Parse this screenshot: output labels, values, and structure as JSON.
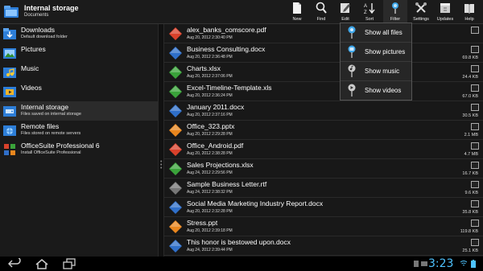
{
  "header": {
    "title": "Internal storage",
    "subtitle": "Documents"
  },
  "toolbar": [
    {
      "label": "New",
      "icon": "new-document-icon"
    },
    {
      "label": "Find",
      "icon": "find-icon"
    },
    {
      "label": "Edit",
      "icon": "edit-icon"
    },
    {
      "label": "Sort",
      "icon": "sort-icon"
    },
    {
      "label": "Filter",
      "icon": "filter-icon"
    },
    {
      "label": "Settings",
      "icon": "settings-icon"
    },
    {
      "label": "Updates",
      "icon": "updates-icon"
    },
    {
      "label": "Help",
      "icon": "help-icon"
    }
  ],
  "sidebar": {
    "items": [
      {
        "label": "Downloads",
        "sub": "Default download folder",
        "icon": "download-folder-icon"
      },
      {
        "label": "Pictures",
        "sub": "",
        "icon": "pictures-icon"
      },
      {
        "label": "Music",
        "sub": "",
        "icon": "music-icon"
      },
      {
        "label": "Videos",
        "sub": "",
        "icon": "videos-icon"
      },
      {
        "label": "Internal storage",
        "sub": "Files saved on internal storage",
        "icon": "internal-storage-icon"
      },
      {
        "label": "Remote files",
        "sub": "Files stored on remote servers",
        "icon": "remote-files-icon"
      },
      {
        "label": "OfficeSuite Professional 6",
        "sub": "Install OfficeSuite Professional",
        "icon": "officesuite-icon"
      }
    ]
  },
  "files": [
    {
      "name": "alex_banks_comscore.pdf",
      "date": "Aug 20, 2012 2:30:40 PM",
      "size": "",
      "type": "pdf",
      "color": "#d9412b"
    },
    {
      "name": "Business Consulting.docx",
      "date": "Aug 20, 2012 2:36:48 PM",
      "size": "69.8 KB",
      "type": "docx",
      "color": "#2f6fc9"
    },
    {
      "name": "Charts.xlsx",
      "date": "Aug 20, 2012 2:37:06 PM",
      "size": "24.4 KB",
      "type": "xlsx",
      "color": "#3aa33a"
    },
    {
      "name": "Excel-Timeline-Template.xls",
      "date": "Aug 20, 2012 2:36:24 PM",
      "size": "67.0 KB",
      "type": "xls",
      "color": "#3aa33a"
    },
    {
      "name": "January 2011.docx",
      "date": "Aug 20, 2012 2:37:16 PM",
      "size": "30.5 KB",
      "type": "docx",
      "color": "#2f6fc9"
    },
    {
      "name": "Office_323.pptx",
      "date": "Aug 20, 2012 2:29:28 PM",
      "size": "2.1 MB",
      "type": "pptx",
      "color": "#e9861e"
    },
    {
      "name": "Office_Android.pdf",
      "date": "Aug 20, 2012 2:38:28 PM",
      "size": "4.7 MB",
      "type": "pdf",
      "color": "#d9412b"
    },
    {
      "name": "Sales Projections.xlsx",
      "date": "Aug 24, 2012 2:29:56 PM",
      "size": "16.7 KB",
      "type": "xlsx",
      "color": "#3aa33a"
    },
    {
      "name": "Sample Business Letter.rtf",
      "date": "Aug 24, 2012 2:38:32 PM",
      "size": "9.6 KB",
      "type": "rtf",
      "color": "#777777"
    },
    {
      "name": "Social Media Marketing Industry Report.docx",
      "date": "Aug 20, 2012 2:32:28 PM",
      "size": "35.8 KB",
      "type": "docx",
      "color": "#2f6fc9"
    },
    {
      "name": "Stress.ppt",
      "date": "Aug 20, 2012 2:39:18 PM",
      "size": "119.8 KB",
      "type": "ppt",
      "color": "#e9861e"
    },
    {
      "name": "This honor is bestowed upon.docx",
      "date": "Aug 24, 2012 2:39:44 PM",
      "size": "25.1 KB",
      "type": "docx",
      "color": "#2f6fc9"
    }
  ],
  "filter_menu": {
    "items": [
      {
        "label": "Show all files",
        "icon": "all-files-filter-icon"
      },
      {
        "label": "Show pictures",
        "icon": "pictures-filter-icon"
      },
      {
        "label": "Show music",
        "icon": "music-filter-icon"
      },
      {
        "label": "Show videos",
        "icon": "videos-filter-icon"
      }
    ]
  },
  "status": {
    "time": "3:23"
  },
  "colors": {
    "accent": "#4ec3ff",
    "background": "#141414"
  }
}
